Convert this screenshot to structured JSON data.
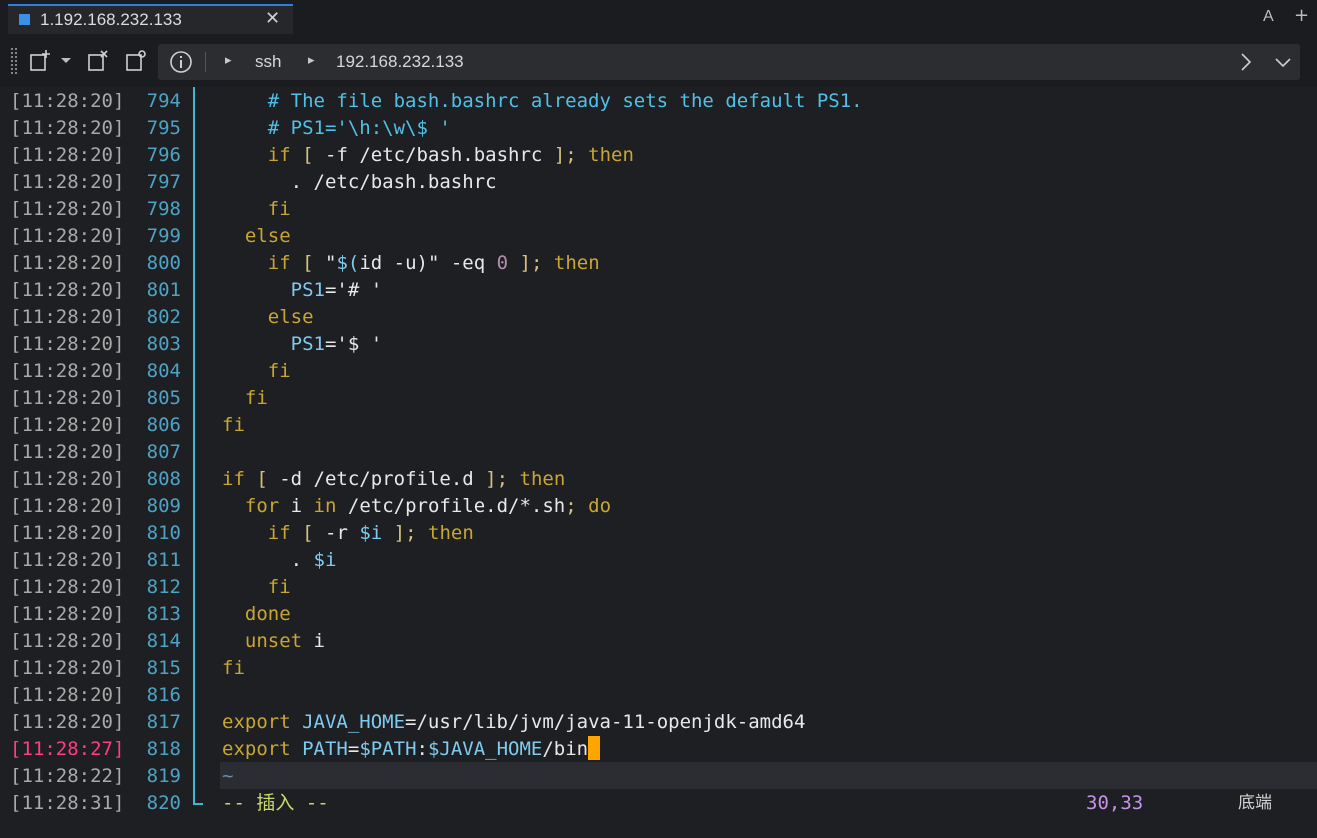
{
  "tab": {
    "title": "1.192.168.232.133",
    "close": "✕"
  },
  "toolbar_right": {
    "font": "A",
    "add": "+"
  },
  "address": {
    "crumbs": [
      "ssh",
      "192.168.232.133"
    ]
  },
  "terminal": {
    "timestamps": [
      "[11:28:20]",
      "[11:28:20]",
      "[11:28:20]",
      "[11:28:20]",
      "[11:28:20]",
      "[11:28:20]",
      "[11:28:20]",
      "[11:28:20]",
      "[11:28:20]",
      "[11:28:20]",
      "[11:28:20]",
      "[11:28:20]",
      "[11:28:20]",
      "[11:28:20]",
      "[11:28:20]",
      "[11:28:20]",
      "[11:28:20]",
      "[11:28:20]",
      "[11:28:20]",
      "[11:28:20]",
      "[11:28:20]",
      "[11:28:20]",
      "[11:28:20]",
      "[11:28:20]",
      "[11:28:27]",
      "[11:28:22]",
      "[11:28:31]"
    ],
    "line_numbers": [
      "794",
      "795",
      "796",
      "797",
      "798",
      "799",
      "800",
      "801",
      "802",
      "803",
      "804",
      "805",
      "806",
      "807",
      "808",
      "809",
      "810",
      "811",
      "812",
      "813",
      "814",
      "815",
      "816",
      "817",
      "818",
      "819",
      "820"
    ],
    "code": [
      "      # The file bash.bashrc already sets the default PS1.",
      "      # PS1='\\h:\\w\\$ '",
      "      if [ -f /etc/bash.bashrc ]; then",
      "        . /etc/bash.bashrc",
      "      fi",
      "    else",
      "      if [ \"$(id -u)\" -eq 0 ]; then",
      "        PS1='# '",
      "      else",
      "        PS1='$ '",
      "      fi",
      "    fi",
      "  fi",
      "",
      "  if [ -d /etc/profile.d ]; then",
      "    for i in /etc/profile.d/*.sh; do",
      "      if [ -r $i ]; then",
      "        . $i",
      "      fi",
      "    done",
      "    unset i",
      "  fi",
      "",
      "  export JAVA_HOME=/usr/lib/jvm/java-11-openjdk-amd64",
      "  export PATH=$PATH:$JAVA_HOME/bin",
      "~"
    ],
    "status": {
      "mode": "-- 插入 --",
      "position": "30,33",
      "scroll": "底端"
    }
  },
  "colors": {
    "accent": "#3b8eea",
    "gutter": "#3fb7d3",
    "cursor": "#ffa500",
    "highlight_timestamp": "#ff3d7f"
  }
}
